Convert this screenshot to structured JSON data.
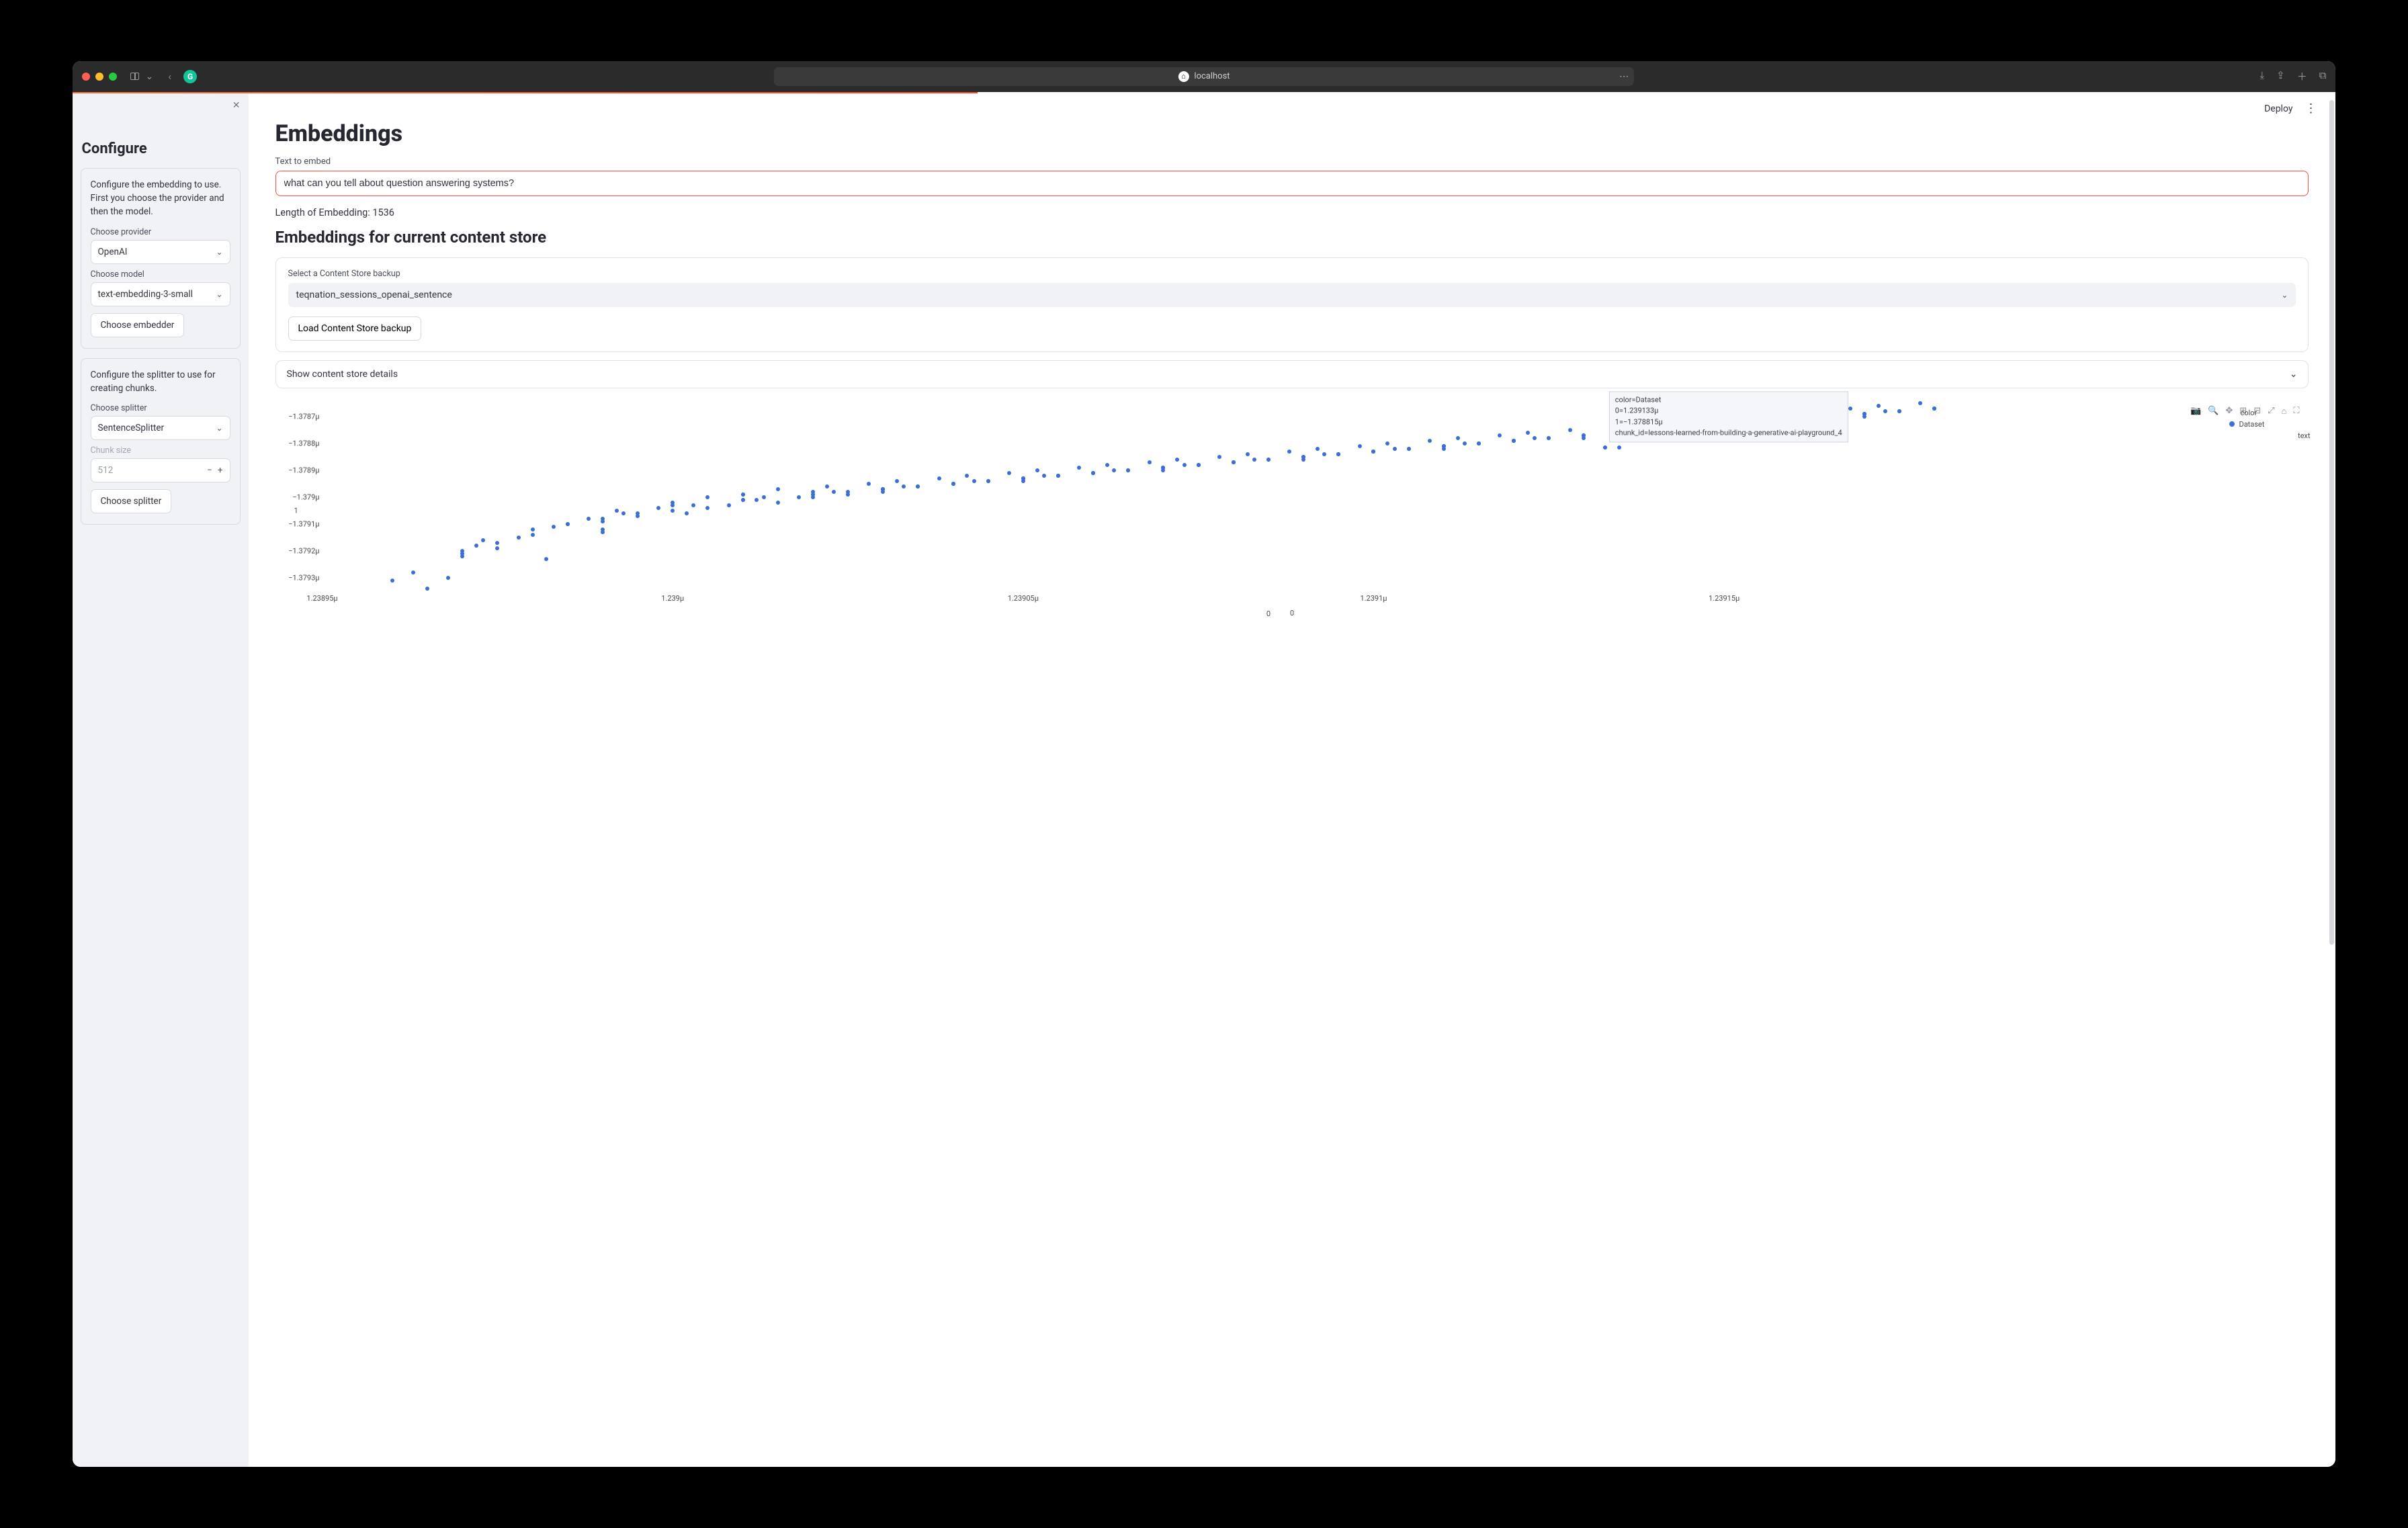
{
  "browser": {
    "host": "localhost"
  },
  "topbar": {
    "deploy": "Deploy"
  },
  "sidebar": {
    "title": "Configure",
    "card1": {
      "para": "Configure the embedding to use. First you choose the provider and then the model.",
      "provider_label": "Choose provider",
      "provider_value": "OpenAI",
      "model_label": "Choose model",
      "model_value": "text-embedding-3-small",
      "embed_btn": "Choose embedder"
    },
    "card2": {
      "para": "Configure the splitter to use for creating chunks.",
      "splitter_label": "Choose splitter",
      "splitter_value": "SentenceSplitter",
      "chunk_label": "Chunk size",
      "chunk_value": "512",
      "split_btn": "Choose splitter"
    }
  },
  "main": {
    "title": "Embeddings",
    "text_label": "Text to embed",
    "text_value": "what can you tell about question answering systems?",
    "length_line": "Length of Embedding: 1536",
    "subtitle": "Embeddings for current content store",
    "backup_label": "Select a Content Store backup",
    "backup_value": "teqnation_sessions_openai_sentence",
    "load_btn": "Load Content Store backup",
    "expander": "Show content store details"
  },
  "chart_data": {
    "type": "scatter",
    "xlabel": "0",
    "ylabel": "1",
    "xlim": [
      1.23895,
      1.23922
    ],
    "ylim": [
      -1.37935,
      -1.37865
    ],
    "x_ticks": [
      1.23895,
      1.239,
      1.23905,
      1.2391,
      1.23915,
      1.2392
    ],
    "x_tick_labels": [
      "1.23895μ",
      "1.239μ",
      "1.23905μ",
      "1.2391μ",
      "1.23915μ"
    ],
    "y_ticks": [
      -1.3787,
      -1.3788,
      -1.3789,
      -1.379,
      -1.3791,
      -1.3792,
      -1.3793
    ],
    "y_tick_labels": [
      "−1.3787μ",
      "−1.3788μ",
      "−1.3789μ",
      "−1.379μ",
      "−1.3791μ",
      "−1.3792μ",
      "−1.3793μ"
    ],
    "legend_title": "color",
    "series": [
      {
        "name": "Dataset",
        "color": "#3b6fd6",
        "x": [
          1.238965,
          1.238968,
          1.23897,
          1.238972,
          1.238975,
          1.238978,
          1.23898,
          1.238982,
          1.238985,
          1.238988,
          1.23899,
          1.238992,
          1.238995,
          1.238998,
          1.239,
          1.239002,
          1.239005,
          1.239008,
          1.23901,
          1.239012,
          1.239015,
          1.239018,
          1.23902,
          1.239022,
          1.239025,
          1.239028,
          1.23903,
          1.239032,
          1.239035,
          1.239038,
          1.23904,
          1.239042,
          1.239045,
          1.239048,
          1.23905,
          1.239052,
          1.239055,
          1.239058,
          1.23906,
          1.239062,
          1.239065,
          1.239068,
          1.23907,
          1.239072,
          1.239075,
          1.239078,
          1.23908,
          1.239082,
          1.239085,
          1.239088,
          1.23909,
          1.239092,
          1.239095,
          1.239098,
          1.2391,
          1.239102,
          1.239105,
          1.239108,
          1.23911,
          1.239112,
          1.239115,
          1.239118,
          1.23912,
          1.239122,
          1.239125,
          1.239128,
          1.23913,
          1.239133,
          1.239135,
          1.239138,
          1.23914,
          1.239142,
          1.239145,
          1.239148,
          1.23915,
          1.239152,
          1.239155,
          1.239158,
          1.23916,
          1.239162,
          1.239165,
          1.239168,
          1.23917,
          1.239172,
          1.239175,
          1.239178,
          1.23918,
          1.238963,
          1.238973,
          1.238983,
          1.238993,
          1.239003,
          1.239013,
          1.239023,
          1.239033,
          1.239043,
          1.239053,
          1.239063,
          1.239073,
          1.239083,
          1.239093,
          1.239103,
          1.239113,
          1.239123,
          1.239133,
          1.239143,
          1.239153,
          1.239163,
          1.239173,
          1.23897,
          1.23899,
          1.23901,
          1.23903,
          1.23905,
          1.23907,
          1.23909,
          1.23911,
          1.23913,
          1.23915,
          1.23917,
          1.23896,
          1.23898,
          1.239,
          1.23902,
          1.23904,
          1.23906,
          1.23908,
          1.2391,
          1.23912,
          1.23914,
          1.23916,
          1.23918,
          1.238975,
          1.239005,
          1.239025,
          1.239045,
          1.239065,
          1.239085,
          1.239105,
          1.239125,
          1.239145,
          1.239165,
          1.238985,
          1.239015,
          1.239035,
          1.239055,
          1.239075,
          1.239095,
          1.239115,
          1.239135,
          1.239155,
          1.239175,
          1.23899,
          1.23902,
          1.23904,
          1.23906,
          1.23908,
          1.2391,
          1.23912,
          1.23914,
          1.23916,
          1.239,
          1.23903,
          1.23905,
          1.23907,
          1.23909,
          1.23911,
          1.23913,
          1.23915,
          1.23917,
          1.238995,
          1.239035,
          1.239055,
          1.239075,
          1.239095,
          1.239115,
          1.239135,
          1.239155,
          1.239175,
          1.23901,
          1.23904,
          1.23906,
          1.23908,
          1.2391,
          1.23912,
          1.23914,
          1.23916,
          1.23918,
          1.23897,
          1.23899,
          1.23901,
          1.23903,
          1.23905,
          1.23907,
          1.23909,
          1.23911,
          1.23913,
          1.23915,
          1.23917
        ],
        "y": [
          -1.37934,
          -1.3793,
          -1.37921,
          -1.37918,
          -1.37919,
          -1.37915,
          -1.37912,
          -1.37923,
          -1.3791,
          -1.37908,
          -1.37913,
          -1.37905,
          -1.37907,
          -1.37904,
          -1.37902,
          -1.37906,
          -1.379,
          -1.37903,
          -1.37899,
          -1.37901,
          -1.37897,
          -1.379,
          -1.37898,
          -1.37896,
          -1.37899,
          -1.37895,
          -1.37897,
          -1.37894,
          -1.37896,
          -1.37893,
          -1.37895,
          -1.37892,
          -1.37894,
          -1.37891,
          -1.37893,
          -1.3789,
          -1.37892,
          -1.37889,
          -1.37891,
          -1.37888,
          -1.3789,
          -1.37887,
          -1.37889,
          -1.37886,
          -1.37888,
          -1.37885,
          -1.37887,
          -1.37884,
          -1.37886,
          -1.37883,
          -1.37885,
          -1.37882,
          -1.37884,
          -1.37881,
          -1.37883,
          -1.3788,
          -1.37882,
          -1.37879,
          -1.37881,
          -1.37878,
          -1.3788,
          -1.37877,
          -1.37879,
          -1.37876,
          -1.37878,
          -1.37875,
          -1.37877,
          -1.378815,
          -1.37876,
          -1.37873,
          -1.37875,
          -1.37872,
          -1.37874,
          -1.37871,
          -1.37873,
          -1.3787,
          -1.37872,
          -1.37869,
          -1.37871,
          -1.37868,
          -1.3787,
          -1.37867,
          -1.37869,
          -1.37866,
          -1.37868,
          -1.37865,
          -1.37867,
          -1.37928,
          -1.37916,
          -1.37911,
          -1.37906,
          -1.37903,
          -1.379,
          -1.37898,
          -1.37896,
          -1.37894,
          -1.37892,
          -1.3789,
          -1.37888,
          -1.37886,
          -1.37884,
          -1.37882,
          -1.3788,
          -1.37878,
          -1.378815,
          -1.37874,
          -1.37872,
          -1.3787,
          -1.37868,
          -1.37922,
          -1.37909,
          -1.37901,
          -1.37897,
          -1.37893,
          -1.37889,
          -1.37885,
          -1.37881,
          -1.37877,
          -1.37873,
          -1.37869,
          -1.37931,
          -1.37914,
          -1.37905,
          -1.37899,
          -1.37895,
          -1.37891,
          -1.37887,
          -1.37883,
          -1.37879,
          -1.37875,
          -1.37871,
          -1.37867,
          -1.37917,
          -1.37904,
          -1.37898,
          -1.37894,
          -1.3789,
          -1.37886,
          -1.37882,
          -1.37878,
          -1.37874,
          -1.3787,
          -1.3791,
          -1.37902,
          -1.37896,
          -1.37892,
          -1.37888,
          -1.37884,
          -1.3788,
          -1.37876,
          -1.37872,
          -1.37868,
          -1.37908,
          -1.379,
          -1.37895,
          -1.37891,
          -1.37887,
          -1.37883,
          -1.37879,
          -1.37875,
          -1.37871,
          -1.37903,
          -1.37897,
          -1.37893,
          -1.37889,
          -1.37885,
          -1.37881,
          -1.37877,
          -1.37873,
          -1.37869,
          -1.37906,
          -1.37896,
          -1.37892,
          -1.37888,
          -1.37884,
          -1.3788,
          -1.378815,
          -1.37872,
          -1.37868,
          -1.37901,
          -1.37895,
          -1.37891,
          -1.37887,
          -1.37883,
          -1.37879,
          -1.37875,
          -1.37871,
          -1.37867,
          -1.3792,
          -1.37912,
          -1.37899,
          -1.37898,
          -1.37894,
          -1.3789,
          -1.37886,
          -1.37882,
          -1.37878,
          -1.37874,
          -1.3787
        ]
      }
    ],
    "extra_legend_text": "text",
    "tooltip": {
      "lines": [
        "color=Dataset",
        "0=1.239133μ",
        "1=−1.378815μ",
        "chunk_id=lessons-learned-from-building-a-generative-ai-playground_4"
      ],
      "at_x": 1.239133,
      "at_y": -1.378815
    }
  }
}
